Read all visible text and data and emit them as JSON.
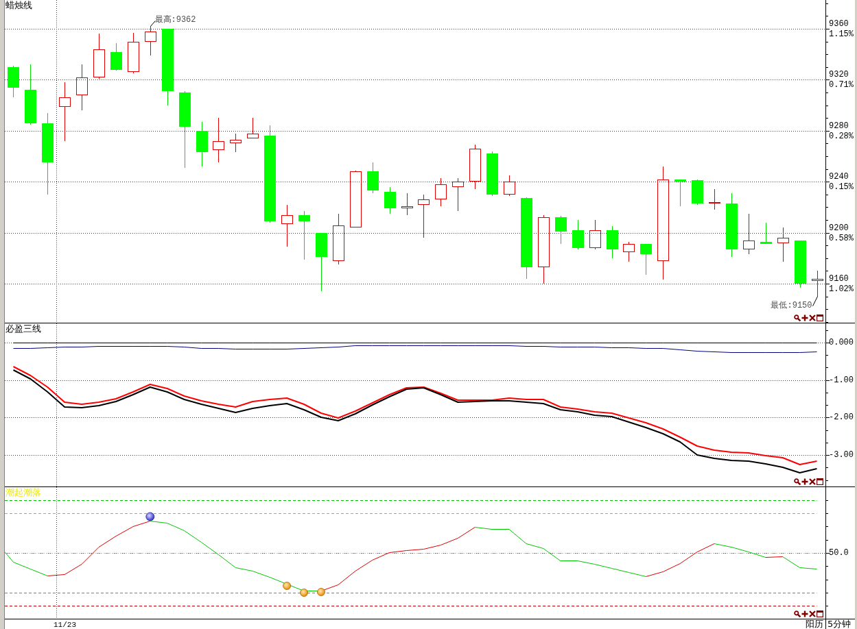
{
  "panels": [
    {
      "kind": "candles",
      "title": "蜡烛线",
      "percent_labels": [
        "1.15%",
        "0.71%",
        "0.28%",
        "0.15%",
        "0.58%",
        "1.02%"
      ],
      "chart_data": {
        "type": "candlestick",
        "grid": true,
        "categories": [
          null,
          null,
          null,
          null,
          null,
          null,
          null,
          null,
          null,
          null,
          null,
          null,
          null,
          null,
          null,
          null,
          null,
          null,
          null,
          null,
          null,
          null,
          null,
          null,
          null,
          null,
          null,
          null,
          null,
          null,
          null,
          null,
          null,
          null,
          null,
          null,
          null,
          null,
          null,
          null,
          null,
          null,
          null,
          null,
          null,
          null,
          null,
          null
        ],
        "ylim": [
          9129.4,
          9382.6
        ],
        "yticks": [
          {
            "value": 9360,
            "label": "9360"
          },
          {
            "value": 9320,
            "label": "9320"
          },
          {
            "value": 9280,
            "label": "9280"
          },
          {
            "value": 9240,
            "label": "9240"
          },
          {
            "value": 9200,
            "label": "9200"
          },
          {
            "value": 9160,
            "label": "9160"
          }
        ],
        "ohlc": [
          [
            9330,
            9331,
            9306,
            9314
          ],
          [
            9312,
            9332,
            9285,
            9286
          ],
          [
            9286,
            9294,
            9230,
            9255
          ],
          [
            9299,
            9318,
            9272,
            9306
          ],
          [
            9308,
            9332,
            9296,
            9322
          ],
          [
            9322,
            9356,
            9321,
            9344
          ],
          [
            9342,
            9349,
            9327,
            9328
          ],
          [
            9326,
            9357,
            9325,
            9350
          ],
          [
            9350,
            9362,
            9339,
            9358
          ],
          [
            9360,
            9360,
            9300,
            9311
          ],
          [
            9310,
            9311,
            9251,
            9283
          ],
          [
            9280,
            9287,
            9252,
            9263
          ],
          [
            9265,
            9290,
            9255,
            9272
          ],
          [
            9270,
            9278,
            9263,
            9273
          ],
          [
            9274,
            9290,
            9274,
            9278
          ],
          [
            9276,
            9284,
            9208,
            9209
          ],
          [
            9207,
            9222,
            9189,
            9214
          ],
          [
            9214,
            9217,
            9179,
            9209
          ],
          [
            9200,
            9200,
            9154,
            9181
          ],
          [
            9178,
            9215,
            9175,
            9206
          ],
          [
            9204,
            9249,
            9204,
            9248
          ],
          [
            9248,
            9255,
            9231,
            9233
          ],
          [
            9232,
            9236,
            9215,
            9219
          ],
          [
            9219,
            9231,
            9214,
            9221
          ],
          [
            9222,
            9230,
            9196,
            9226
          ],
          [
            9226,
            9243,
            9221,
            9238
          ],
          [
            9236,
            9243,
            9217,
            9240
          ],
          [
            9240,
            9269,
            9234,
            9266
          ],
          [
            9262,
            9264,
            9229,
            9230
          ],
          [
            9230,
            9245,
            9229,
            9240
          ],
          [
            9227,
            9228,
            9164,
            9173
          ],
          [
            9173,
            9214,
            9160,
            9212
          ],
          [
            9212,
            9213,
            9191,
            9201
          ],
          [
            9202,
            9210,
            9187,
            9188
          ],
          [
            9188,
            9210,
            9187,
            9202
          ],
          [
            9202,
            9205,
            9180,
            9187
          ],
          [
            9185,
            9193,
            9177,
            9191
          ],
          [
            9191,
            9191,
            9167,
            9183
          ],
          [
            9178,
            9252,
            9163,
            9242
          ],
          [
            9242,
            9242,
            9221,
            9240
          ],
          [
            9241,
            9242,
            9222,
            9223
          ],
          [
            9223,
            9234,
            9218,
            9224
          ],
          [
            9223,
            9231,
            9181,
            9187
          ],
          [
            9187,
            9215,
            9183,
            9194
          ],
          [
            9193,
            9208,
            9191,
            9191
          ],
          [
            9192,
            9204,
            9177,
            9196
          ],
          [
            9194,
            9194,
            9157,
            9160
          ],
          [
            9162,
            9170,
            9150,
            9164
          ]
        ],
        "annotations": [
          {
            "y": 9362,
            "text": "最高:9362"
          },
          "最低:9150"
        ]
      }
    },
    {
      "kind": "lines",
      "title": "必盈三线",
      "chart_data": {
        "type": "line",
        "grid": true,
        "categories": [
          null,
          null,
          null,
          null,
          null,
          null,
          null,
          null,
          null,
          null,
          null,
          null,
          null,
          null,
          null,
          null,
          null,
          null,
          null,
          null,
          null,
          null,
          null,
          null,
          null,
          null,
          null,
          null,
          null,
          null,
          null,
          null,
          null,
          null,
          null,
          null,
          null,
          null,
          null,
          null,
          null,
          null,
          null,
          null,
          null,
          null,
          null,
          null
        ],
        "ylim": [
          -3.84,
          0.51
        ],
        "yticks": [
          {
            "value": 0,
            "label": "0.000"
          },
          {
            "value": -1,
            "label": "-1.00"
          },
          {
            "value": -2,
            "label": "-2.00"
          },
          {
            "value": -3,
            "label": "-3.00"
          }
        ],
        "series": [
          {
            "color": "#000000",
            "values": [
              0,
              0,
              0,
              0,
              0,
              0,
              0,
              0,
              0,
              0,
              0,
              0,
              0,
              0,
              0,
              0,
              0,
              0,
              0,
              0,
              0,
              0,
              0,
              0,
              0,
              0,
              0,
              0,
              0,
              0,
              0,
              0,
              0,
              0,
              0,
              0,
              0,
              0,
              0,
              0,
              0,
              0,
              0,
              0,
              0,
              0,
              0,
              0
            ]
          },
          {
            "color": "#000080",
            "values": [
              -0.15,
              -0.14,
              -0.13,
              -0.12,
              -0.11,
              -0.09,
              -0.09,
              -0.09,
              -0.09,
              -0.1,
              -0.12,
              -0.14,
              -0.15,
              -0.16,
              -0.16,
              -0.16,
              -0.16,
              -0.15,
              -0.13,
              -0.11,
              -0.08,
              -0.07,
              -0.07,
              -0.07,
              -0.07,
              -0.07,
              -0.07,
              -0.07,
              -0.07,
              -0.08,
              -0.09,
              -0.1,
              -0.11,
              -0.11,
              -0.12,
              -0.13,
              -0.13,
              -0.14,
              -0.15,
              -0.18,
              -0.22,
              -0.24,
              -0.25,
              -0.25,
              -0.25,
              -0.25,
              -0.26,
              -0.24
            ]
          },
          {
            "color": "#ff0000",
            "values": [
              -0.64,
              -0.88,
              -1.19,
              -1.59,
              -1.65,
              -1.59,
              -1.5,
              -1.32,
              -1.12,
              -1.22,
              -1.43,
              -1.55,
              -1.65,
              -1.72,
              -1.57,
              -1.52,
              -1.48,
              -1.65,
              -1.88,
              -2.01,
              -1.83,
              -1.61,
              -1.39,
              -1.21,
              -1.19,
              -1.35,
              -1.54,
              -1.54,
              -1.54,
              -1.48,
              -1.52,
              -1.52,
              -1.72,
              -1.77,
              -1.85,
              -1.88,
              -2.01,
              -2.14,
              -2.3,
              -2.52,
              -2.76,
              -2.87,
              -2.93,
              -2.94,
              -3.02,
              -3.07,
              -3.25,
              -3.16
            ]
          },
          {
            "color": "#000000",
            "values": [
              -0.73,
              -0.97,
              -1.32,
              -1.72,
              -1.74,
              -1.68,
              -1.57,
              -1.39,
              -1.19,
              -1.32,
              -1.52,
              -1.65,
              -1.76,
              -1.86,
              -1.76,
              -1.68,
              -1.63,
              -1.79,
              -1.99,
              -2.08,
              -1.9,
              -1.66,
              -1.44,
              -1.24,
              -1.21,
              -1.39,
              -1.59,
              -1.57,
              -1.55,
              -1.55,
              -1.59,
              -1.63,
              -1.79,
              -1.85,
              -1.94,
              -1.97,
              -2.12,
              -2.27,
              -2.43,
              -2.65,
              -3,
              -3.09,
              -3.14,
              -3.16,
              -3.24,
              -3.33,
              -3.47,
              -3.36
            ]
          }
        ]
      }
    },
    {
      "kind": "oscillator",
      "title": "潮起潮落",
      "axis_label": "50.0"
    }
  ],
  "time_axis": {
    "date_label": "11/23",
    "calendar": "阳历",
    "period": "5分钟"
  }
}
